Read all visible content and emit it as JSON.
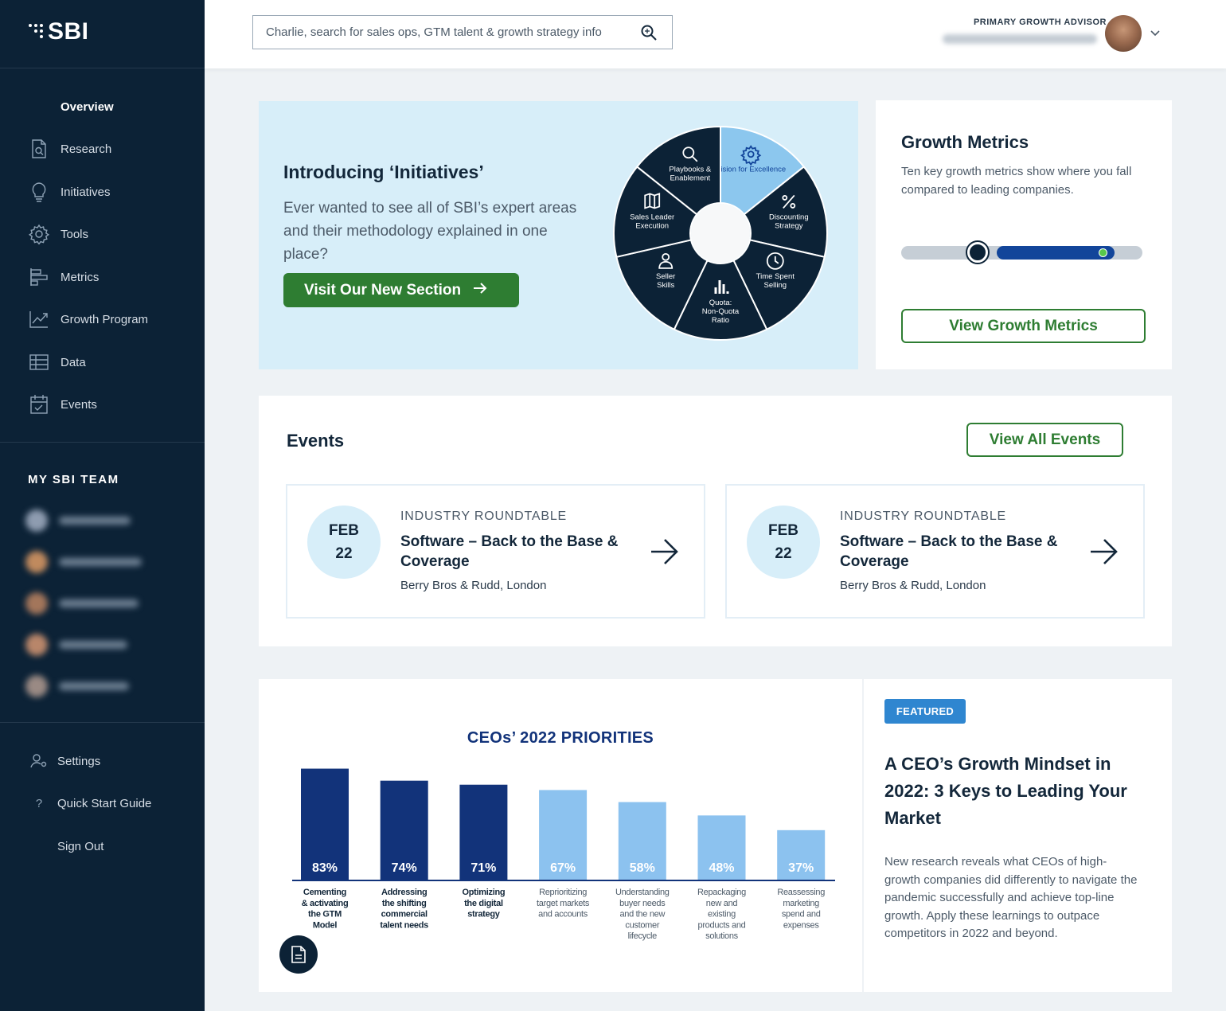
{
  "brand": {
    "logo_text": "SBI"
  },
  "search": {
    "placeholder": "Charlie, search for sales ops, GTM talent & growth strategy info"
  },
  "advisor": {
    "label": "PRIMARY GROWTH ADVISOR"
  },
  "sidebar": {
    "items": [
      {
        "label": "Overview",
        "icon": "none"
      },
      {
        "label": "Research",
        "icon": "document-search-icon"
      },
      {
        "label": "Initiatives",
        "icon": "lightbulb-icon"
      },
      {
        "label": "Tools",
        "icon": "gear-icon"
      },
      {
        "label": "Metrics",
        "icon": "bar-chart-icon"
      },
      {
        "label": "Growth Program",
        "icon": "line-chart-icon"
      },
      {
        "label": "Data",
        "icon": "table-icon"
      },
      {
        "label": "Events",
        "icon": "calendar-icon"
      }
    ],
    "team_title": "MY SBI TEAM",
    "bottom": [
      {
        "label": "Settings",
        "icon": "user-settings-icon"
      },
      {
        "label": "Quick Start Guide",
        "icon": "question-icon"
      },
      {
        "label": "Sign Out",
        "icon": "none"
      }
    ]
  },
  "initiatives": {
    "title": "Introducing ‘Initiatives’",
    "text": "Ever wanted to see all of SBI’s expert areas and their methodology explained in one place?",
    "button": "Visit Our New Section",
    "wheel": [
      {
        "label": "Vision for Excellence",
        "icon": "gear-icon",
        "highlight": true
      },
      {
        "label": "Discounting Strategy",
        "icon": "percent-icon",
        "highlight": false
      },
      {
        "label": "Time Spent Selling",
        "icon": "clock-icon",
        "highlight": false
      },
      {
        "label": "Quota: Non-Quota Ratio",
        "icon": "bar-chart-icon",
        "highlight": false
      },
      {
        "label": "Seller Skills",
        "icon": "person-icon",
        "highlight": false
      },
      {
        "label": "Sales Leader Execution",
        "icon": "map-icon",
        "highlight": false
      },
      {
        "label": "Playbooks & Enablement",
        "icon": "search-icon",
        "highlight": false
      }
    ]
  },
  "growth_metrics": {
    "title": "Growth Metrics",
    "text": "Ten key growth metrics show where you fall compared to leading companies.",
    "button": "View Growth Metrics"
  },
  "events": {
    "title": "Events",
    "view_all": "View All Events",
    "items": [
      {
        "month": "FEB",
        "day": "22",
        "type": "INDUSTRY ROUNDTABLE",
        "name": "Software – Back to the Base & Coverage",
        "location": "Berry Bros & Rudd, London"
      },
      {
        "month": "FEB",
        "day": "22",
        "type": "INDUSTRY ROUNDTABLE",
        "name": "Software – Back to the Base & Coverage",
        "location": "Berry Bros & Rudd, London"
      }
    ]
  },
  "chart_data": {
    "type": "bar",
    "title": "CEOs’ 2022 PRIORITIES",
    "categories": [
      "Cementing & activating the GTM Model",
      "Addressing the shifting commercial talent needs",
      "Optimizing the digital strategy",
      "Reprioritizing target markets and accounts",
      "Understanding buyer needs and the new customer lifecycle",
      "Repackaging new and existing products and solutions",
      "Reassessing marketing spend and expenses"
    ],
    "category_lines": [
      [
        "Cementing",
        "& activating",
        "the GTM",
        "Model"
      ],
      [
        "Addressing",
        "the shifting",
        "commercial",
        "talent needs"
      ],
      [
        "Optimizing",
        "the digital",
        "strategy"
      ],
      [
        "Reprioritizing",
        "target markets",
        "and accounts"
      ],
      [
        "Understanding",
        "buyer needs",
        "and the new",
        "customer",
        "lifecycle"
      ],
      [
        "Repackaging",
        "new and",
        "existing",
        "products and",
        "solutions"
      ],
      [
        "Reassessing",
        "marketing",
        "spend and",
        "expenses"
      ]
    ],
    "values": [
      83,
      74,
      71,
      67,
      58,
      48,
      37
    ],
    "value_labels": [
      "83%",
      "74%",
      "71%",
      "67%",
      "58%",
      "48%",
      "37%"
    ],
    "highlight": [
      true,
      true,
      true,
      false,
      false,
      false,
      false
    ],
    "colors": {
      "highlight": "#12337a",
      "normal": "#8cc2ef"
    },
    "ylim": [
      0,
      100
    ],
    "xlabel": "",
    "ylabel": "",
    "grid": false
  },
  "featured": {
    "badge": "FEATURED",
    "title": "A CEO’s Growth Mindset in 2022: 3 Keys to Leading Your Market",
    "text": "New research reveals what CEOs of high-growth companies did differently to navigate the pandemic successfully and achieve top-line growth. Apply these learnings to outpace competitors in 2022 and beyond."
  }
}
